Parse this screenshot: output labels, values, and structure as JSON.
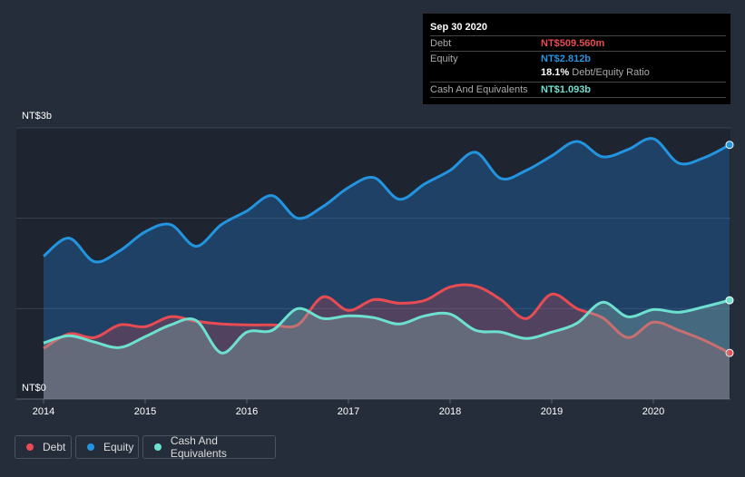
{
  "tooltip": {
    "date": "Sep 30 2020",
    "debt_label": "Debt",
    "debt_value": "NT$509.560m",
    "equity_label": "Equity",
    "equity_value": "NT$2.812b",
    "ratio_value": "18.1%",
    "ratio_label": "Debt/Equity Ratio",
    "cash_label": "Cash And Equivalents",
    "cash_value": "NT$1.093b"
  },
  "legend": [
    {
      "label": "Debt",
      "color": "#e84b52"
    },
    {
      "label": "Equity",
      "color": "#2394df"
    },
    {
      "label": "Cash And Equivalents",
      "color": "#6ee0cf"
    }
  ],
  "chart_data": {
    "type": "area",
    "ylabel_top": "NT$3b",
    "ylabel_bottom": "NT$0",
    "ylim": [
      0,
      3
    ],
    "xlim": [
      2013.75,
      2020.8
    ],
    "x_ticks": [
      "2014",
      "2015",
      "2016",
      "2017",
      "2018",
      "2019",
      "2020"
    ],
    "x": [
      2014,
      2014.25,
      2014.5,
      2014.75,
      2015,
      2015.25,
      2015.5,
      2015.75,
      2016,
      2016.25,
      2016.5,
      2016.75,
      2017,
      2017.25,
      2017.5,
      2017.75,
      2018,
      2018.25,
      2018.5,
      2018.75,
      2019,
      2019.25,
      2019.5,
      2019.75,
      2020,
      2020.25,
      2020.5,
      2020.75
    ],
    "series": [
      {
        "name": "Equity",
        "color": "#2394df",
        "values": [
          1.58,
          1.78,
          1.52,
          1.64,
          1.85,
          1.93,
          1.69,
          1.93,
          2.08,
          2.25,
          2.0,
          2.13,
          2.34,
          2.45,
          2.21,
          2.38,
          2.53,
          2.73,
          2.44,
          2.53,
          2.69,
          2.85,
          2.68,
          2.76,
          2.88,
          2.61,
          2.67,
          2.812
        ]
      },
      {
        "name": "Debt",
        "color": "#e84b52",
        "values": [
          0.56,
          0.72,
          0.68,
          0.82,
          0.8,
          0.91,
          0.86,
          0.83,
          0.82,
          0.82,
          0.82,
          1.13,
          0.98,
          1.1,
          1.06,
          1.09,
          1.24,
          1.25,
          1.1,
          0.89,
          1.16,
          1.0,
          0.9,
          0.68,
          0.85,
          0.76,
          0.65,
          0.51
        ]
      },
      {
        "name": "Cash And Equivalents",
        "color": "#6ee0cf",
        "values": [
          0.62,
          0.7,
          0.63,
          0.57,
          0.69,
          0.82,
          0.87,
          0.51,
          0.74,
          0.76,
          1.0,
          0.89,
          0.92,
          0.9,
          0.83,
          0.92,
          0.94,
          0.76,
          0.74,
          0.67,
          0.74,
          0.84,
          1.07,
          0.91,
          0.99,
          0.96,
          1.02,
          1.093
        ]
      }
    ]
  }
}
